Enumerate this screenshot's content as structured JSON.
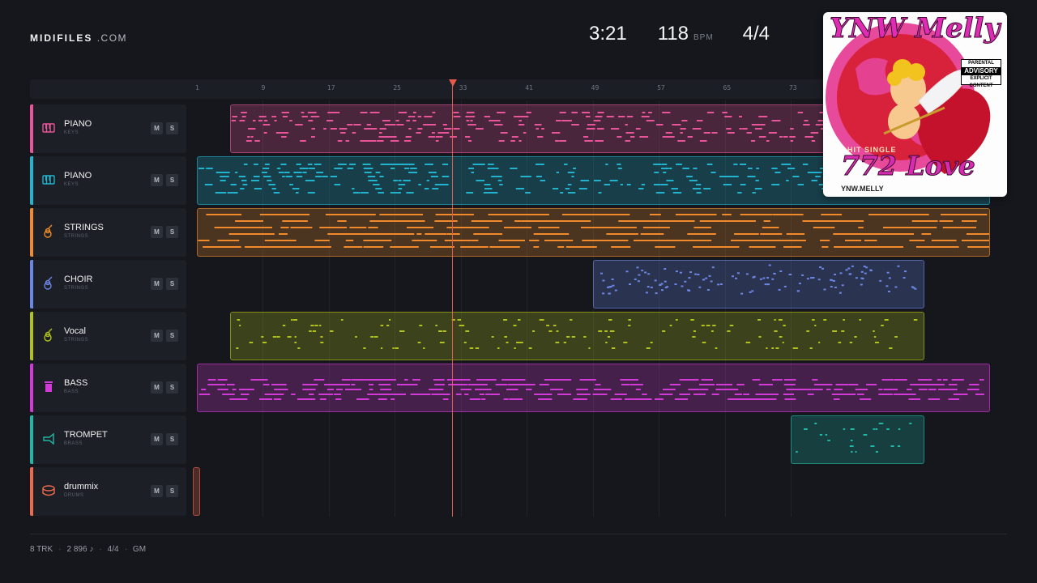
{
  "brand": {
    "name": "MIDIFILES",
    "domain": ".COM"
  },
  "transport": {
    "time": "3:21",
    "bpm": "118",
    "bpm_unit": "BPM",
    "signature": "4/4"
  },
  "ruler": {
    "marks": [
      "1",
      "9",
      "17",
      "25",
      "33",
      "41",
      "49",
      "57",
      "65",
      "73"
    ]
  },
  "playhead_bar": 33,
  "tracks": [
    {
      "name": "PIANO",
      "category": "KEYS",
      "color": "#e8559a",
      "icon": "piano-icon",
      "mute": "M",
      "solo": "S"
    },
    {
      "name": "PIANO",
      "category": "KEYS",
      "color": "#22b3cf",
      "icon": "piano-icon",
      "mute": "M",
      "solo": "S"
    },
    {
      "name": "STRINGS",
      "category": "STRINGS",
      "color": "#f08a2a",
      "icon": "guitar-icon",
      "mute": "M",
      "solo": "S"
    },
    {
      "name": "CHOIR",
      "category": "STRINGS",
      "color": "#6c86e6",
      "icon": "guitar-icon",
      "mute": "M",
      "solo": "S"
    },
    {
      "name": "Vocal",
      "category": "STRINGS",
      "color": "#b2c21c",
      "icon": "guitar-icon",
      "mute": "M",
      "solo": "S"
    },
    {
      "name": "BASS",
      "category": "BASS",
      "color": "#d23ad7",
      "icon": "bass-icon",
      "mute": "M",
      "solo": "S"
    },
    {
      "name": "TROMPET",
      "category": "BRASS",
      "color": "#1fb7a8",
      "icon": "trumpet-icon",
      "mute": "M",
      "solo": "S"
    },
    {
      "name": "drummix",
      "category": "DRUMS",
      "color": "#ee6a4e",
      "icon": "drum-icon",
      "mute": "M",
      "solo": "S"
    }
  ],
  "footer": {
    "tracks": "8 TRK",
    "notes": "2 896 ♪",
    "signature": "4/4",
    "standard": "GM"
  },
  "cover": {
    "artist": "YNW Melly",
    "title": "772 Love",
    "label": "HIT SINGLE",
    "advisory_top": "PARENTAL",
    "advisory_mid": "ADVISORY",
    "advisory_bottom": "EXPLICIT CONTENT",
    "handle": "YNW.MELLY"
  }
}
